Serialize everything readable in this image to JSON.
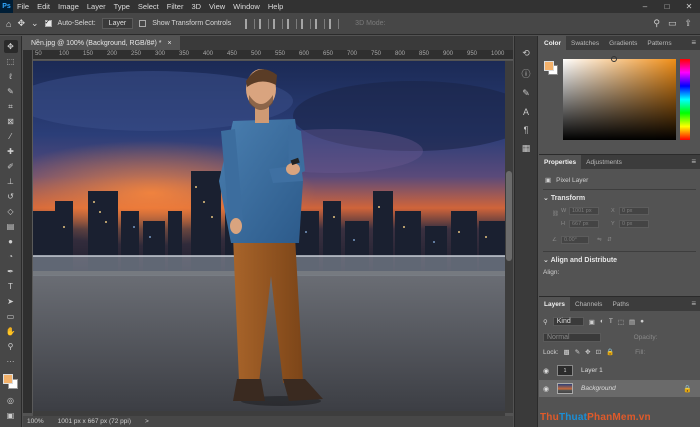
{
  "menu": {
    "logo": "Ps",
    "items": [
      "File",
      "Edit",
      "Image",
      "Layer",
      "Type",
      "Select",
      "Filter",
      "3D",
      "View",
      "Window",
      "Help"
    ],
    "window_controls": [
      "–",
      "□",
      "✕"
    ]
  },
  "options": {
    "auto_select_label": "Auto-Select:",
    "auto_select_value": "Layer",
    "transform_controls_label": "Show Transform Controls",
    "mode_3d_label": "3D Mode:"
  },
  "document": {
    "tab_title": "Nền.jpg @ 100% (Background, RGB/8#) *",
    "close_glyph": "×",
    "ruler_labels": [
      "50",
      "100",
      "150",
      "200",
      "250",
      "300",
      "350",
      "400",
      "450",
      "500",
      "550",
      "600",
      "650",
      "700",
      "750",
      "800",
      "850",
      "900",
      "950",
      "1000"
    ]
  },
  "status": {
    "zoom": "100%",
    "doc_info": "1001 px x 667 px (72 ppi)",
    "arrow": ">"
  },
  "colors": {
    "foreground": "#f3b16a",
    "background": "#ffffff",
    "picker_hue": "#f08e17"
  },
  "color_panel": {
    "tabs": [
      "Color",
      "Swatches",
      "Gradients",
      "Patterns"
    ]
  },
  "properties_panel": {
    "tabs": [
      "Properties",
      "Adjustments"
    ],
    "pixel_layer_label": "Pixel Layer",
    "transform_heading": "Transform",
    "w_label": "W",
    "h_label": "H",
    "x_label": "X",
    "y_label": "Y",
    "w_value": "1001 px",
    "h_value": "667 px",
    "x_value": "0 px",
    "y_value": "0 px",
    "angle_value": "0.00°",
    "align_heading": "Align and Distribute",
    "align_label": "Align:"
  },
  "layers_panel": {
    "tabs": [
      "Layers",
      "Channels",
      "Paths"
    ],
    "kind_label": "Kind",
    "blend_mode": "Normal",
    "opacity_label": "Opacity:",
    "lock_label": "Lock:",
    "fill_label": "Fill:",
    "layers": [
      {
        "name": "Layer 1",
        "visible": true,
        "selected": false
      },
      {
        "name": "Background",
        "visible": true,
        "selected": true
      }
    ]
  },
  "watermark": {
    "part1": "Thu",
    "part2": "Thuat",
    "part3": "PhanMem",
    "suffix": ".vn"
  }
}
